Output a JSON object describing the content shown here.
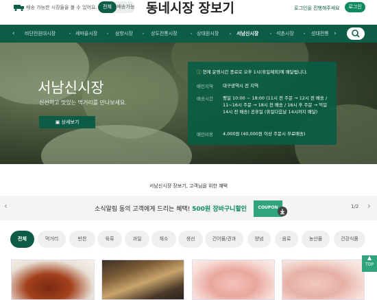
{
  "header": {
    "delivery_note": "배송 가능한 시장들을 볼 수 있어요.",
    "toggle": [
      "전체",
      "배송가능"
    ],
    "brand": "동네시장 장보기",
    "login_note": "로그인을 진행해주세요",
    "login_label": "로그인"
  },
  "nav": {
    "items": [
      "비단전원대시장",
      "세마을시장",
      "삼방시장",
      "상도전통시장",
      "상대원시장",
      "서남신시장",
      "석촌시장",
      "성대전통"
    ],
    "active": "서남신시장",
    "prev_icon": "chevron-left-icon",
    "next_icon": "chevron-right-icon",
    "search_icon": "search-icon"
  },
  "hero": {
    "title": "서남신시장",
    "subtitle": "신선하고 맛있는 먹거리를 만나보세요.",
    "detail_label": "상세보기",
    "notice": "현재 운영시간 종료로 오후 1시(휴일제외)에 배달됩니다.",
    "info": [
      {
        "key": "배민지역",
        "value": "대구광역시 전 지역"
      },
      {
        "key": "배송시간",
        "value": "평일 10:00 ~ 18:00 (11시 전 주문 → 12시 전 배송 / 11~16시 주문 → 18시 전 배송 / 16시 후 주문 → 익일 14시 전 배송) 공휴일 (휴일다음날 14시까지 배달)"
      },
      {
        "key": "배민비용",
        "value": "4,000원 (40,000원 이상 주문시 무료배송)"
      }
    ]
  },
  "caption": "서남신시장 장보기, 고객님을 위한 혜택",
  "promo": {
    "text_prefix": "소식알림 동의 고객에게 드리는 혜택!",
    "text_highlight": "500원 장바구니할인",
    "coupon_label": "COUPON",
    "pager": "1/2"
  },
  "categories": {
    "items": [
      "전체",
      "먹거리",
      "반찬",
      "육류",
      "과일",
      "채소",
      "생선",
      "건어물/견과",
      "양념",
      "음료",
      "농산물",
      "건강식품"
    ],
    "active": "전체"
  },
  "top_label": "TOP",
  "colors": {
    "brand_green": "#0d5c45",
    "accent_green": "#0d8a5f"
  }
}
